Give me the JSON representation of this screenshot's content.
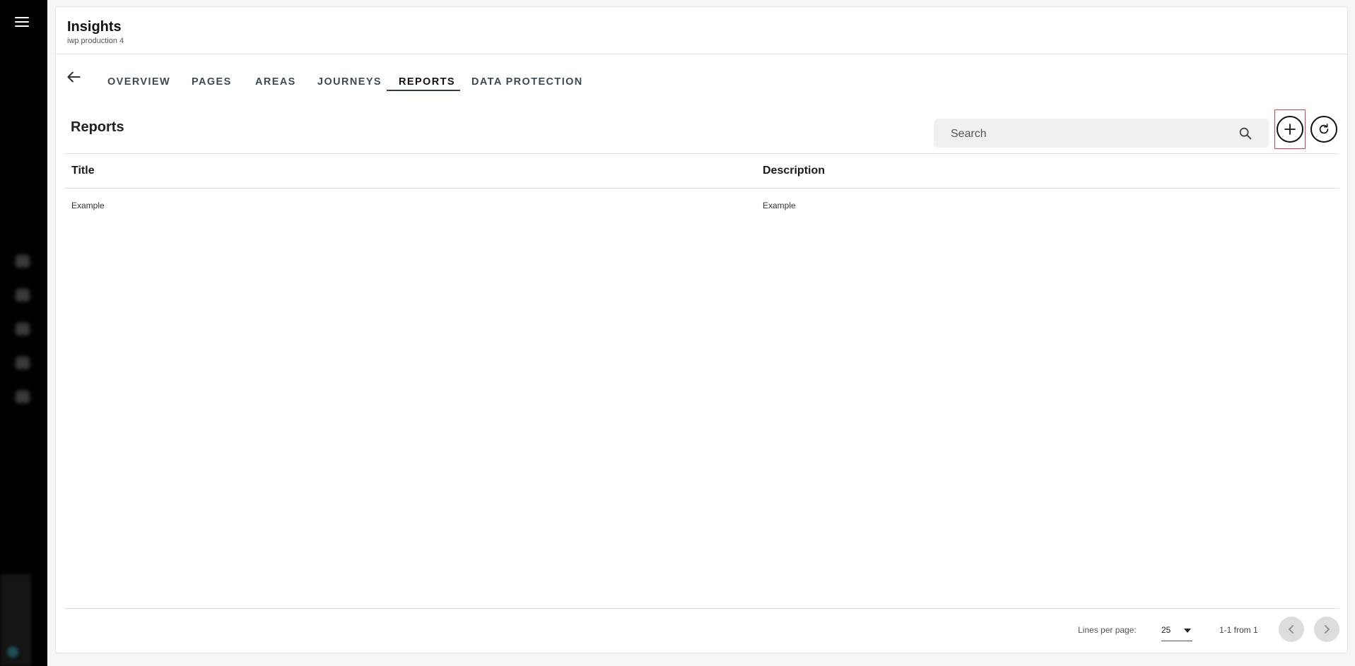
{
  "app": {
    "title": "Insights",
    "subtitle": "iwp production 4"
  },
  "tabs": [
    {
      "label": "OVERVIEW",
      "active": false
    },
    {
      "label": "PAGES",
      "active": false
    },
    {
      "label": "AREAS",
      "active": false
    },
    {
      "label": "JOURNEYS",
      "active": false
    },
    {
      "label": "REPORTS",
      "active": true
    },
    {
      "label": "DATA PROTECTION",
      "active": false
    }
  ],
  "section": {
    "title": "Reports"
  },
  "search": {
    "placeholder": "Search"
  },
  "table": {
    "columns": [
      "Title",
      "Description"
    ],
    "rows": [
      {
        "title": "Example",
        "description": "Example"
      }
    ]
  },
  "pagination": {
    "lines_per_page_label": "Lines per page:",
    "lines_per_page_value": "25",
    "range_text": "1-1 from 1"
  },
  "icons": {
    "menu": "hamburger-menu-icon",
    "back": "arrow-left-icon",
    "search": "search-icon",
    "add": "plus-icon",
    "refresh": "refresh-icon",
    "prev": "chevron-left-icon",
    "next": "chevron-right-icon"
  },
  "colors": {
    "rail": "#000000",
    "active_tab_underline": "#2d3c48",
    "highlight": "#e0404b"
  }
}
